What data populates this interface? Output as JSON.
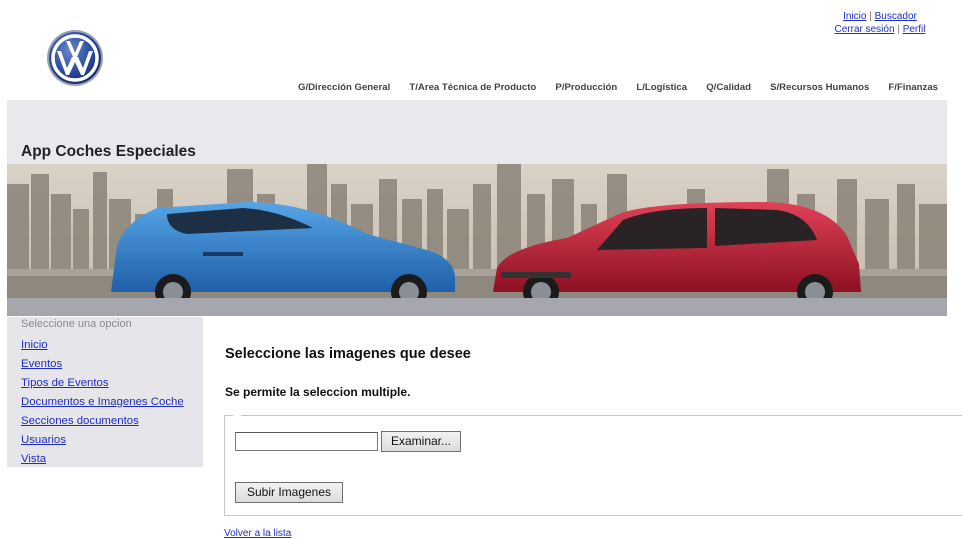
{
  "header": {
    "util_links": {
      "inicio": "Inicio",
      "separator": "|",
      "buscador": "Buscador",
      "cerrar_sesion": "Cerrar sesión",
      "perfil": "Perfil"
    },
    "logo": "vw-logo",
    "nav": [
      "G/Dirección General",
      "T/Area Técnica de Producto",
      "P/Producción",
      "L/Logística",
      "Q/Calidad",
      "S/Recursos Humanos",
      "F/Finanzas"
    ],
    "app_title": "App Coches Especiales"
  },
  "sidebar": {
    "heading": "Seleccione una opcion",
    "items": [
      "Inicio",
      "Eventos",
      "Tipos de Eventos",
      "Documentos e Imagenes Coche",
      "Secciones documentos",
      "Usuarios",
      "Vista"
    ]
  },
  "main": {
    "title": "Seleccione las imagenes que desee",
    "note": "Se permite la seleccion multiple.",
    "file_input_value": "",
    "browse_label": "Examinar...",
    "upload_label": "Subir Imagenes",
    "back_link": "Volver a la lista"
  },
  "colors": {
    "band": "#e9e9ed",
    "sidebar": "#e6e6ea",
    "link": "#1e2ec8",
    "car_blue": "#3b8fd6",
    "car_red": "#c81f3a"
  }
}
